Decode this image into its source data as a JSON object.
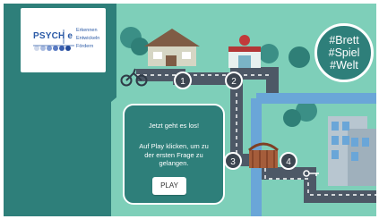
{
  "logo": {
    "wordmark": "PSYCH e",
    "tagline": [
      "Erkennen",
      "Entwickeln",
      "Fördern"
    ]
  },
  "title_bubble": {
    "lines": [
      "#Brett",
      "#Spiel",
      "#Welt"
    ]
  },
  "start_panel": {
    "heading": "Jetzt geht es los!",
    "instructions": "Auf Play klicken, um zu der ersten Frage zu gelangen.",
    "play_label": "PLAY"
  },
  "board": {
    "stations": [
      "1",
      "2",
      "3",
      "4"
    ]
  },
  "colors": {
    "frame": "#2e7f7a",
    "grass": "#7ecfb9",
    "road": "#4d5866",
    "river": "#6aa6d8",
    "station": "#3d4651"
  },
  "icons": [
    "bicycle-icon",
    "house-icon",
    "shop-icon",
    "trees-icon",
    "bridge-icon",
    "office-building-icon",
    "key-icon"
  ]
}
